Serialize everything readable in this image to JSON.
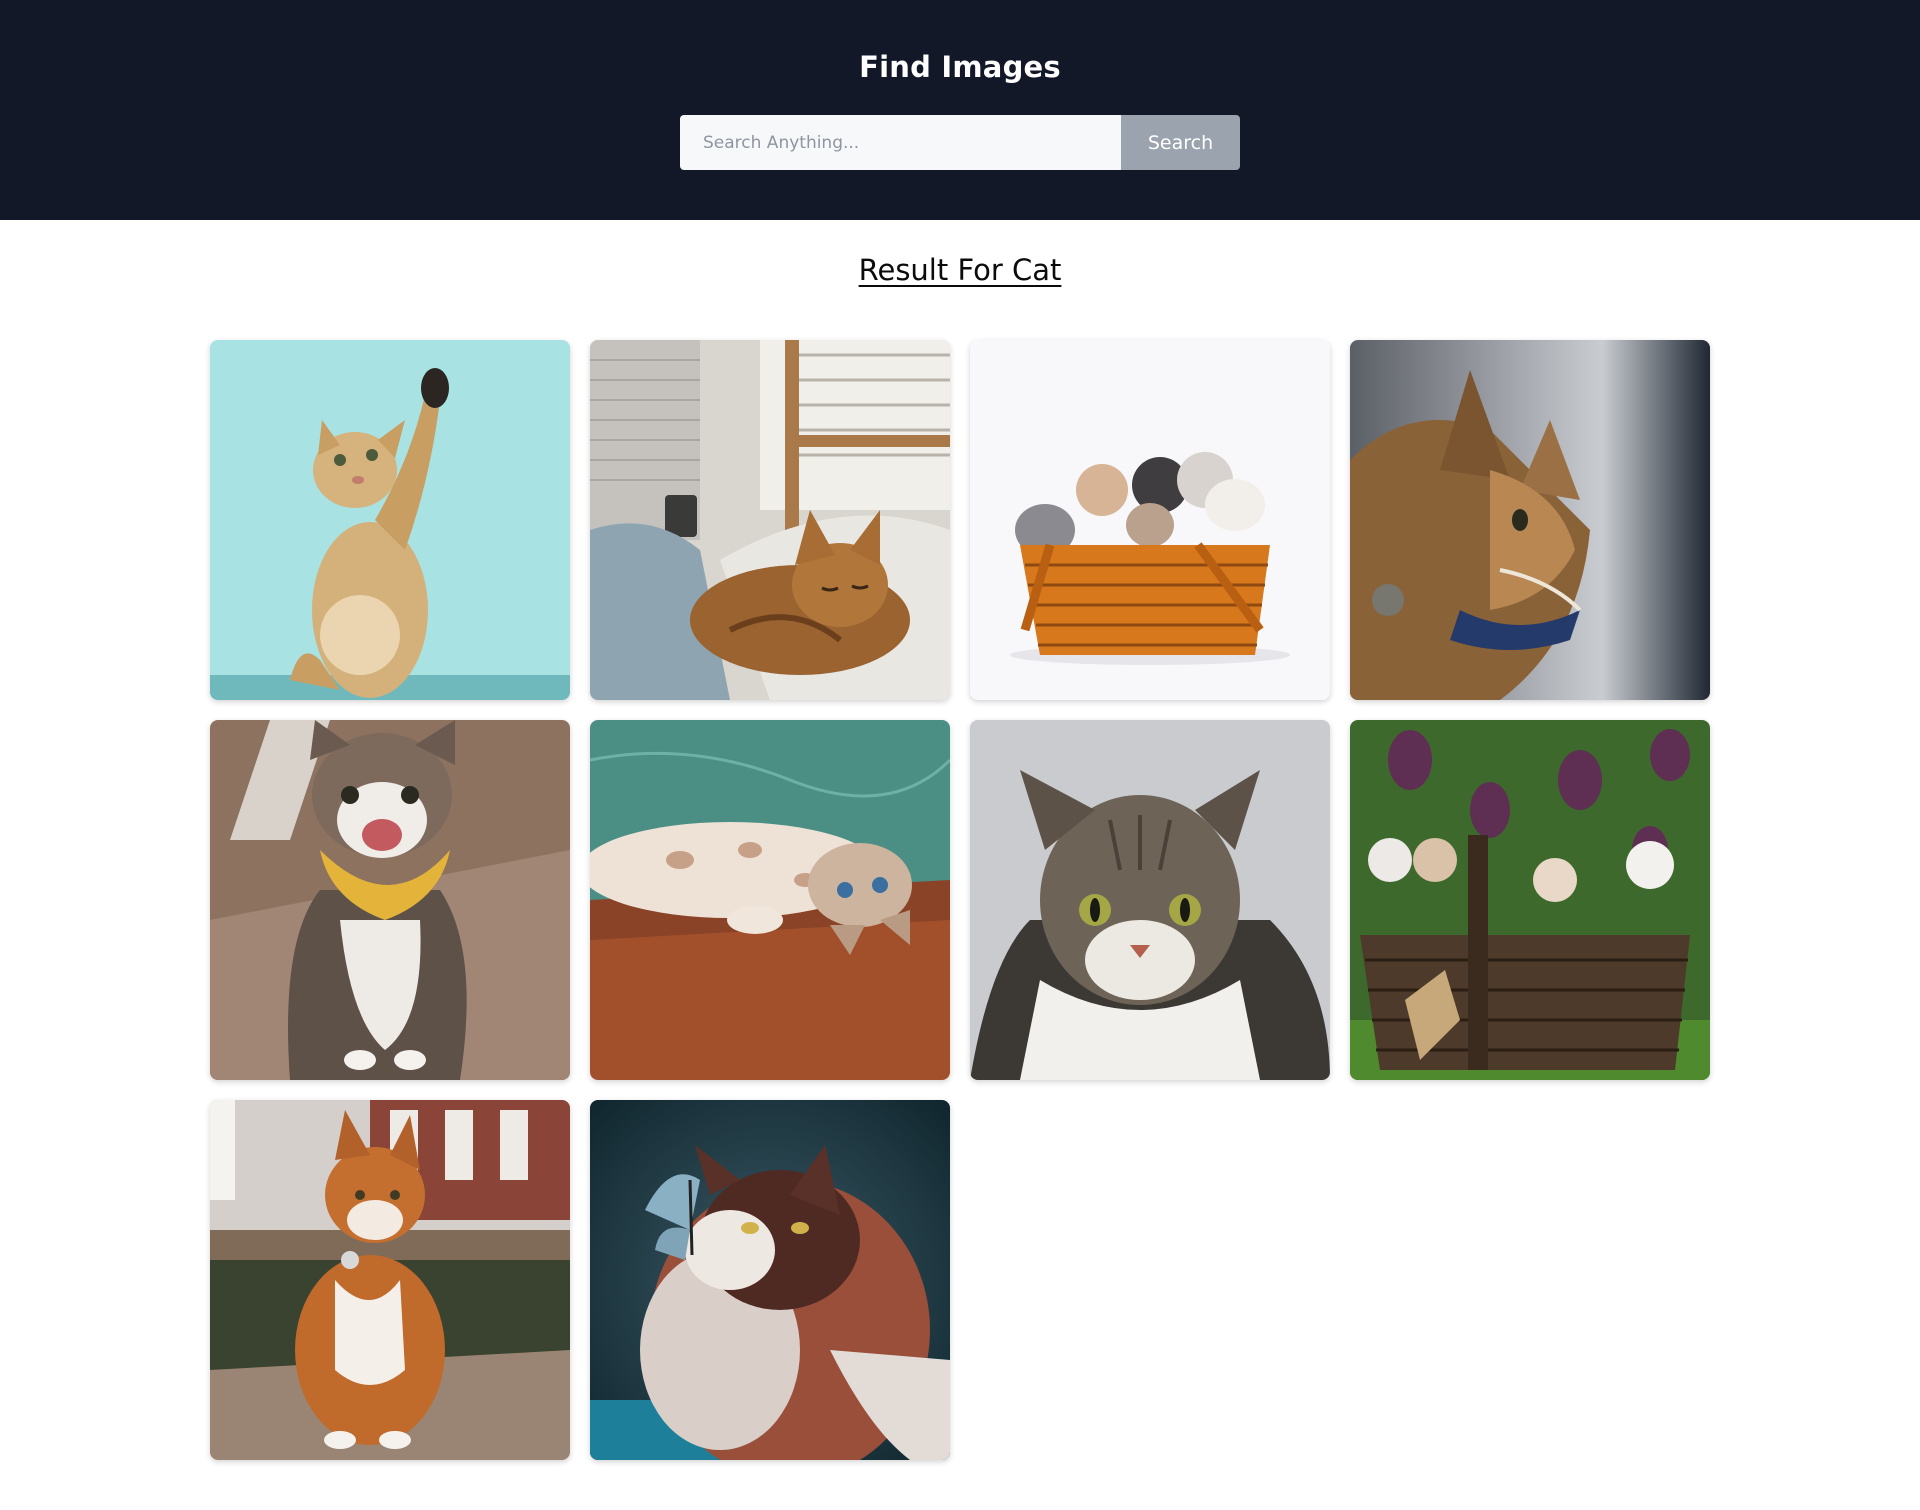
{
  "header": {
    "title": "Find Images",
    "background_color": "#121828"
  },
  "search": {
    "placeholder": "Search Anything...",
    "value": "",
    "button_label": "Search",
    "button_color": "#9ba3ae"
  },
  "results": {
    "title": "Result For Cat",
    "images": [
      {
        "subject": "kitten reaching up on turquoise background"
      },
      {
        "subject": "orange tabby sleeping on bed by window"
      },
      {
        "subject": "kittens in wicker basket on white background"
      },
      {
        "subject": "tabby cat profile with blue collar"
      },
      {
        "subject": "happy tabby cat with yellow bandana on wooden floor"
      },
      {
        "subject": "cat lying upside down on wooden floor"
      },
      {
        "subject": "tabby cat portrait against grey wall"
      },
      {
        "subject": "kittens in wooden basket under lilacs"
      },
      {
        "subject": "orange cat sitting by canal"
      },
      {
        "subject": "fluffy cat with butterfly on nose"
      }
    ]
  }
}
